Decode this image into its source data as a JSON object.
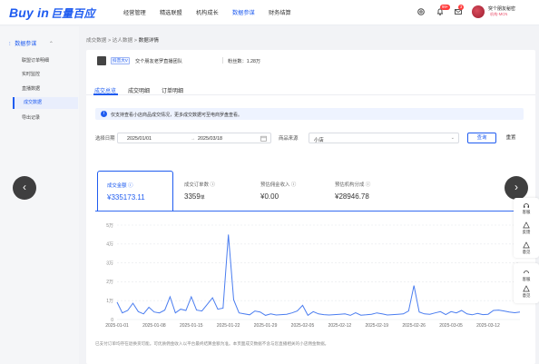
{
  "brand": {
    "logo_text": "Buy in",
    "logo_cn": "巨量百应"
  },
  "top_nav": {
    "items": [
      "经营管理",
      "精选联盟",
      "机构成长",
      "数据参谋",
      "财务结算"
    ],
    "active_index": 3,
    "bell_badge": "99+",
    "mail_badge": "3"
  },
  "user": {
    "name": "突个朋友秘密",
    "tag": "机构·MCN"
  },
  "sidebar": {
    "group": "数据参谋",
    "items": [
      "联盟订单明细",
      "实时监控",
      "直播数据",
      "成交数据",
      "导出记录"
    ],
    "active_index": 3
  },
  "breadcrumb": {
    "a": "成交数据",
    "b": "达人数据",
    "c": "数据详情"
  },
  "shop": {
    "tag": "抖音大V",
    "name": "交个朋友老罗直播团队",
    "fans": "粉丝数：1.28万"
  },
  "tabs": {
    "items": [
      "成交总览",
      "成交明细",
      "订单明细"
    ],
    "active_index": 0
  },
  "notice": "仅支持查看小店商品成交情况，更多成交数据可至电商罗盘查看。",
  "filters": {
    "date_label": "选择日期",
    "date_from": "2025/01/01",
    "date_to": "2025/03/18",
    "source_label": "商品来源",
    "source_value": "小店",
    "search_label": "查询",
    "reset_label": "重置"
  },
  "metrics": [
    {
      "label": "成交金额",
      "value": "¥335173.11",
      "unit": ""
    },
    {
      "label": "成交订单数",
      "value": "3359",
      "unit": "单"
    },
    {
      "label": "预估佣金收入",
      "value": "¥0.00",
      "unit": ""
    },
    {
      "label": "预估机构分成",
      "value": "¥28946.78",
      "unit": ""
    }
  ],
  "footnote": "已支付订单均存在退换货可能。可优质佣金收入以平台最终结算金额为准。本页面成交数据不含与您直播相关的小店佣金数据。",
  "float_panel": {
    "upper": [
      "客服",
      "反馈",
      "意见"
    ],
    "lower": [
      "客服",
      "意见"
    ]
  },
  "chart_data": {
    "type": "line",
    "ylim": [
      0,
      50000
    ],
    "yticks": [
      0,
      10000,
      20000,
      30000,
      40000,
      50000
    ],
    "ytick_labels": [
      "0",
      "1万",
      "2万",
      "3万",
      "4万",
      "5万"
    ],
    "xtick_labels": [
      "2025-01-01",
      "2025-01-08",
      "2025-01-15",
      "2025-01-22",
      "2025-01-29",
      "2025-02-05",
      "2025-02-12",
      "2025-02-19",
      "2025-02-26",
      "2025-03-05",
      "2025-03-12"
    ],
    "xtick_days": [
      0,
      7,
      14,
      21,
      28,
      35,
      42,
      49,
      56,
      63,
      70
    ],
    "grid": true,
    "color": "#4a7df0",
    "series": [
      {
        "values": [
          9200,
          3500,
          4800,
          8600,
          4200,
          3000,
          6500,
          4000,
          3500,
          5000,
          12000,
          3500,
          5500,
          4800,
          12000,
          5000,
          4500,
          8000,
          11500,
          5500,
          6000,
          45000,
          10500,
          3500,
          3000,
          2500,
          4500,
          4000,
          2200,
          3000,
          2400,
          2600,
          2800,
          3500,
          4500,
          7500,
          2200,
          4200,
          3000,
          2600,
          2400,
          2600,
          2800,
          3000,
          2200,
          3600,
          2300,
          2500,
          2800,
          3500,
          3000,
          2400,
          2600,
          2800,
          3000,
          4500,
          18000,
          4000,
          3000,
          2800,
          3500,
          4200,
          2600,
          4200,
          3500,
          4800,
          3000,
          2500,
          3200,
          2600,
          2800,
          4800,
          5000,
          4500,
          4000,
          3600,
          4000
        ]
      }
    ]
  }
}
